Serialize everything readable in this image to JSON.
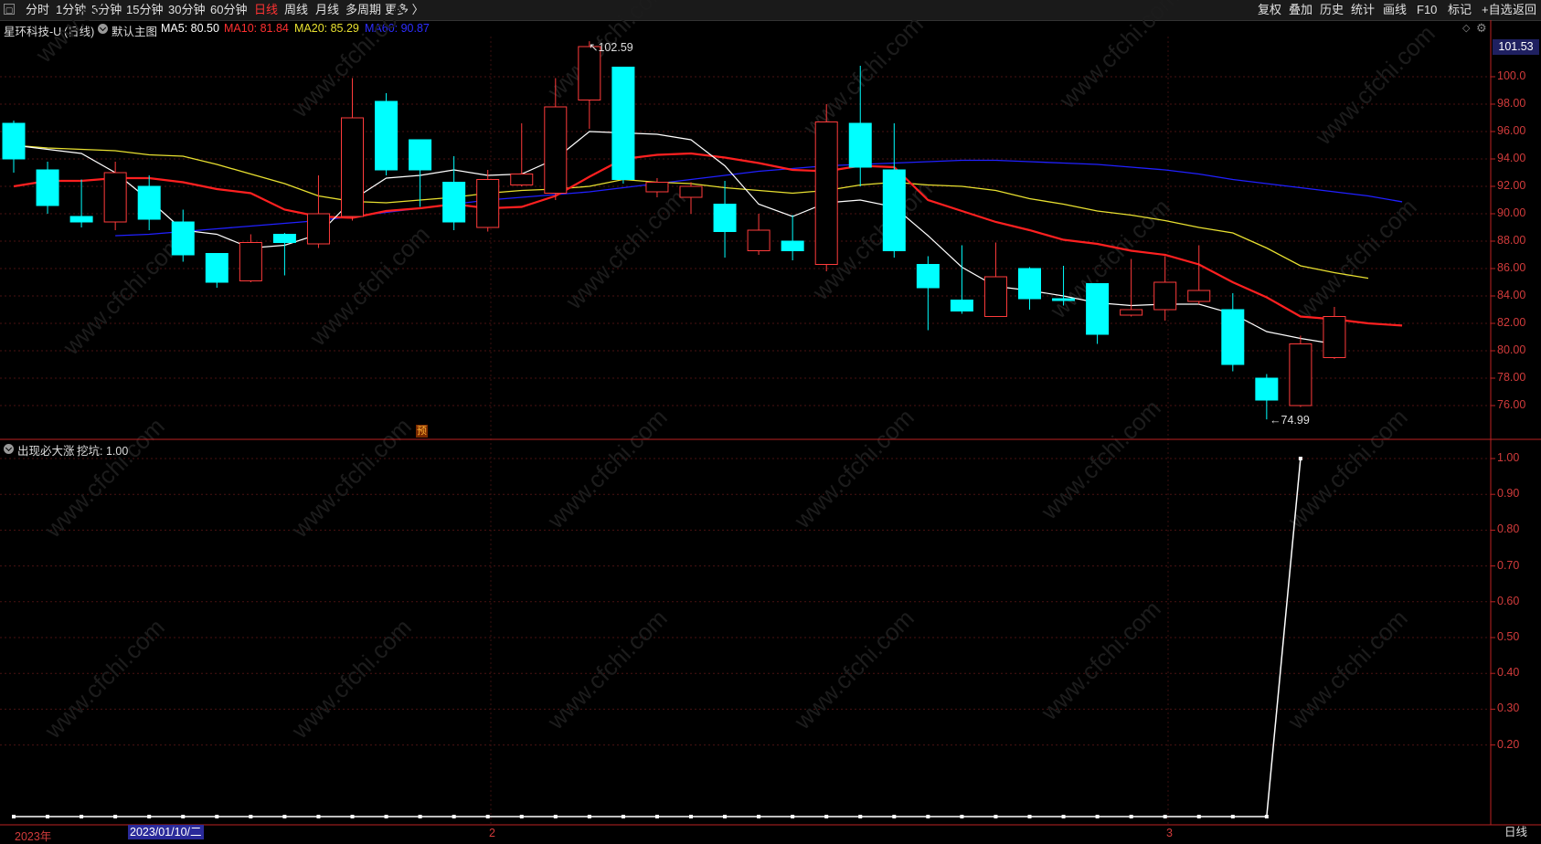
{
  "toolbar": {
    "periods": [
      {
        "label": "分时",
        "active": false
      },
      {
        "label": "1分钟",
        "active": false
      },
      {
        "label": "5分钟",
        "active": false
      },
      {
        "label": "15分钟",
        "active": false
      },
      {
        "label": "30分钟",
        "active": false
      },
      {
        "label": "60分钟",
        "active": false
      },
      {
        "label": "日线",
        "active": true
      },
      {
        "label": "周线",
        "active": false
      },
      {
        "label": "月线",
        "active": false
      },
      {
        "label": "多周期",
        "active": false
      },
      {
        "label": "更多 〉",
        "active": false
      }
    ],
    "right_buttons": [
      "复权",
      "叠加",
      "历史",
      "统计",
      "画线",
      "F10",
      "+自选",
      "返回"
    ],
    "mark_label": "标记"
  },
  "info": {
    "stock": "星环科技-U",
    "period": "(日线)",
    "template": "默认主图",
    "ma5": "MA5: 80.50",
    "ma10": "MA10: 81.84",
    "ma20": "MA20: 85.29",
    "ma60": "MA60: 90.87",
    "colors": {
      "ma5": "#ffffff",
      "ma10": "#ff2020",
      "ma20": "#e8e030",
      "ma60": "#2020ff"
    }
  },
  "price_axis": {
    "labels": [
      "100.0",
      "98.00",
      "96.00",
      "94.00",
      "92.00",
      "90.00",
      "88.00",
      "86.00",
      "84.00",
      "82.00",
      "80.00",
      "78.00",
      "76.00"
    ],
    "current": "101.53",
    "high_mark": "102.59",
    "low_mark": "74.99"
  },
  "indicator": {
    "name": "出现必大涨",
    "value": "挖坑: 1.00",
    "axis": [
      "1.00",
      "0.90",
      "0.80",
      "0.70",
      "0.60",
      "0.50",
      "0.40",
      "0.30",
      "0.20"
    ]
  },
  "dates": {
    "year": "2023年",
    "selected": "2023/01/10/二",
    "m2": "2",
    "m3": "3"
  },
  "period_label": "日线",
  "pre_badge": "预",
  "chart_data": {
    "type": "candlestick",
    "ylim": [
      74.99,
      102.59
    ],
    "candles": [
      {
        "o": 96.6,
        "c": 94.0,
        "h": 96.8,
        "l": 93.0
      },
      {
        "o": 93.2,
        "c": 90.6,
        "h": 93.8,
        "l": 90.0
      },
      {
        "o": 89.8,
        "c": 89.4,
        "h": 92.5,
        "l": 89.0
      },
      {
        "o": 89.4,
        "c": 93.0,
        "h": 93.8,
        "l": 88.8
      },
      {
        "o": 92.0,
        "c": 89.6,
        "h": 92.8,
        "l": 88.8
      },
      {
        "o": 89.4,
        "c": 87.0,
        "h": 90.3,
        "l": 86.5
      },
      {
        "o": 87.1,
        "c": 85.0,
        "h": 87.1,
        "l": 84.6
      },
      {
        "o": 85.1,
        "c": 87.9,
        "h": 88.5,
        "l": 85.0
      },
      {
        "o": 88.5,
        "c": 87.9,
        "h": 88.6,
        "l": 85.5
      },
      {
        "o": 87.8,
        "c": 90.0,
        "h": 92.8,
        "l": 87.5
      },
      {
        "o": 89.8,
        "c": 97.0,
        "h": 99.9,
        "l": 89.5
      },
      {
        "o": 98.2,
        "c": 93.2,
        "h": 98.8,
        "l": 92.8
      },
      {
        "o": 95.4,
        "c": 93.2,
        "h": 95.4,
        "l": 90.5
      },
      {
        "o": 92.3,
        "c": 89.4,
        "h": 94.2,
        "l": 88.8
      },
      {
        "o": 89.0,
        "c": 92.5,
        "h": 93.2,
        "l": 88.7
      },
      {
        "o": 92.1,
        "c": 92.9,
        "h": 96.6,
        "l": 92.0
      },
      {
        "o": 91.5,
        "c": 97.8,
        "h": 99.9,
        "l": 91.0
      },
      {
        "o": 98.3,
        "c": 102.2,
        "h": 102.59,
        "l": 96.2
      },
      {
        "o": 100.7,
        "c": 92.5,
        "h": 100.7,
        "l": 92.2
      },
      {
        "o": 91.6,
        "c": 92.3,
        "h": 92.6,
        "l": 91.2
      },
      {
        "o": 91.2,
        "c": 92.0,
        "h": 92.3,
        "l": 90.0
      },
      {
        "o": 90.7,
        "c": 88.7,
        "h": 92.4,
        "l": 86.8
      },
      {
        "o": 87.3,
        "c": 88.8,
        "h": 90.0,
        "l": 87.0
      },
      {
        "o": 88.0,
        "c": 87.3,
        "h": 89.9,
        "l": 86.6
      },
      {
        "o": 86.3,
        "c": 96.7,
        "h": 98.0,
        "l": 85.8
      },
      {
        "o": 96.6,
        "c": 93.4,
        "h": 100.8,
        "l": 92.0
      },
      {
        "o": 93.2,
        "c": 87.3,
        "h": 96.6,
        "l": 86.8
      },
      {
        "o": 86.3,
        "c": 84.6,
        "h": 86.9,
        "l": 81.5
      },
      {
        "o": 83.7,
        "c": 82.9,
        "h": 87.7,
        "l": 82.7
      },
      {
        "o": 82.5,
        "c": 85.4,
        "h": 87.9,
        "l": 82.5
      },
      {
        "o": 86.0,
        "c": 83.8,
        "h": 86.1,
        "l": 83.0
      },
      {
        "o": 83.8,
        "c": 83.7,
        "h": 86.2,
        "l": 83.3
      },
      {
        "o": 84.9,
        "c": 81.2,
        "h": 84.9,
        "l": 80.5
      },
      {
        "o": 82.6,
        "c": 83.0,
        "h": 86.7,
        "l": 82.5
      },
      {
        "o": 83.0,
        "c": 85.0,
        "h": 86.9,
        "l": 82.2
      },
      {
        "o": 83.6,
        "c": 84.4,
        "h": 87.7,
        "l": 83.4
      },
      {
        "o": 83.0,
        "c": 79.0,
        "h": 84.2,
        "l": 78.5
      },
      {
        "o": 78.0,
        "c": 76.4,
        "h": 78.3,
        "l": 74.99
      },
      {
        "o": 76.0,
        "c": 80.5,
        "h": 81.1,
        "l": 75.9
      },
      {
        "o": 79.5,
        "c": 82.5,
        "h": 83.2,
        "l": 79.4
      }
    ],
    "ma5": [
      95.0,
      94.7,
      94.4,
      93.0,
      91.0,
      88.8,
      88.5,
      87.5,
      87.7,
      88.5,
      91.0,
      92.6,
      92.8,
      93.2,
      92.8,
      92.9,
      94.0,
      96.0,
      95.9,
      95.8,
      95.4,
      93.5,
      90.7,
      89.8,
      90.8,
      91.0,
      90.5,
      88.4,
      86.1,
      84.7,
      84.4,
      84.0,
      83.5,
      83.3,
      83.4,
      83.4,
      82.7,
      81.4,
      80.9,
      80.5
    ],
    "ma10": [
      92.0,
      92.4,
      92.4,
      92.6,
      92.6,
      92.3,
      91.8,
      91.5,
      90.3,
      89.8,
      89.7,
      90.2,
      90.4,
      90.7,
      90.4,
      90.5,
      91.3,
      92.7,
      94.0,
      94.3,
      94.4,
      94.1,
      93.7,
      93.2,
      93.1,
      93.5,
      93.4,
      91.0,
      90.2,
      89.4,
      88.8,
      88.1,
      87.8,
      87.3,
      87.0,
      86.3,
      85.0,
      83.9,
      82.5,
      82.3,
      82.0,
      81.84
    ],
    "ma20": [
      95.0,
      94.8,
      94.7,
      94.6,
      94.3,
      94.2,
      93.6,
      92.9,
      92.2,
      91.3,
      90.9,
      90.8,
      91.0,
      91.2,
      91.5,
      91.7,
      91.8,
      92.0,
      92.5,
      92.3,
      92.2,
      91.9,
      91.7,
      91.5,
      91.7,
      92.1,
      92.3,
      92.1,
      92.0,
      91.7,
      91.1,
      90.7,
      90.2,
      89.9,
      89.5,
      89.0,
      88.6,
      87.5,
      86.2,
      85.7,
      85.29
    ],
    "ma60": [
      88.4,
      88.5,
      88.7,
      88.9,
      89.1,
      89.3,
      89.5,
      89.8,
      90.1,
      90.4,
      90.7,
      91.0,
      91.2,
      91.4,
      91.6,
      91.9,
      92.2,
      92.5,
      92.8,
      93.1,
      93.3,
      93.5,
      93.6,
      93.7,
      93.8,
      93.9,
      93.9,
      93.8,
      93.7,
      93.6,
      93.4,
      93.2,
      92.9,
      92.5,
      92.2,
      91.9,
      91.6,
      91.3,
      90.87
    ],
    "indicator_values": [
      0,
      0,
      0,
      0,
      0,
      0,
      0,
      0,
      0,
      0,
      0,
      0,
      0,
      0,
      0,
      0,
      0,
      0,
      0,
      0,
      0,
      0,
      0,
      0,
      0,
      0,
      0,
      0,
      0,
      0,
      0,
      0,
      0,
      0,
      0,
      0,
      0,
      0,
      1
    ]
  }
}
